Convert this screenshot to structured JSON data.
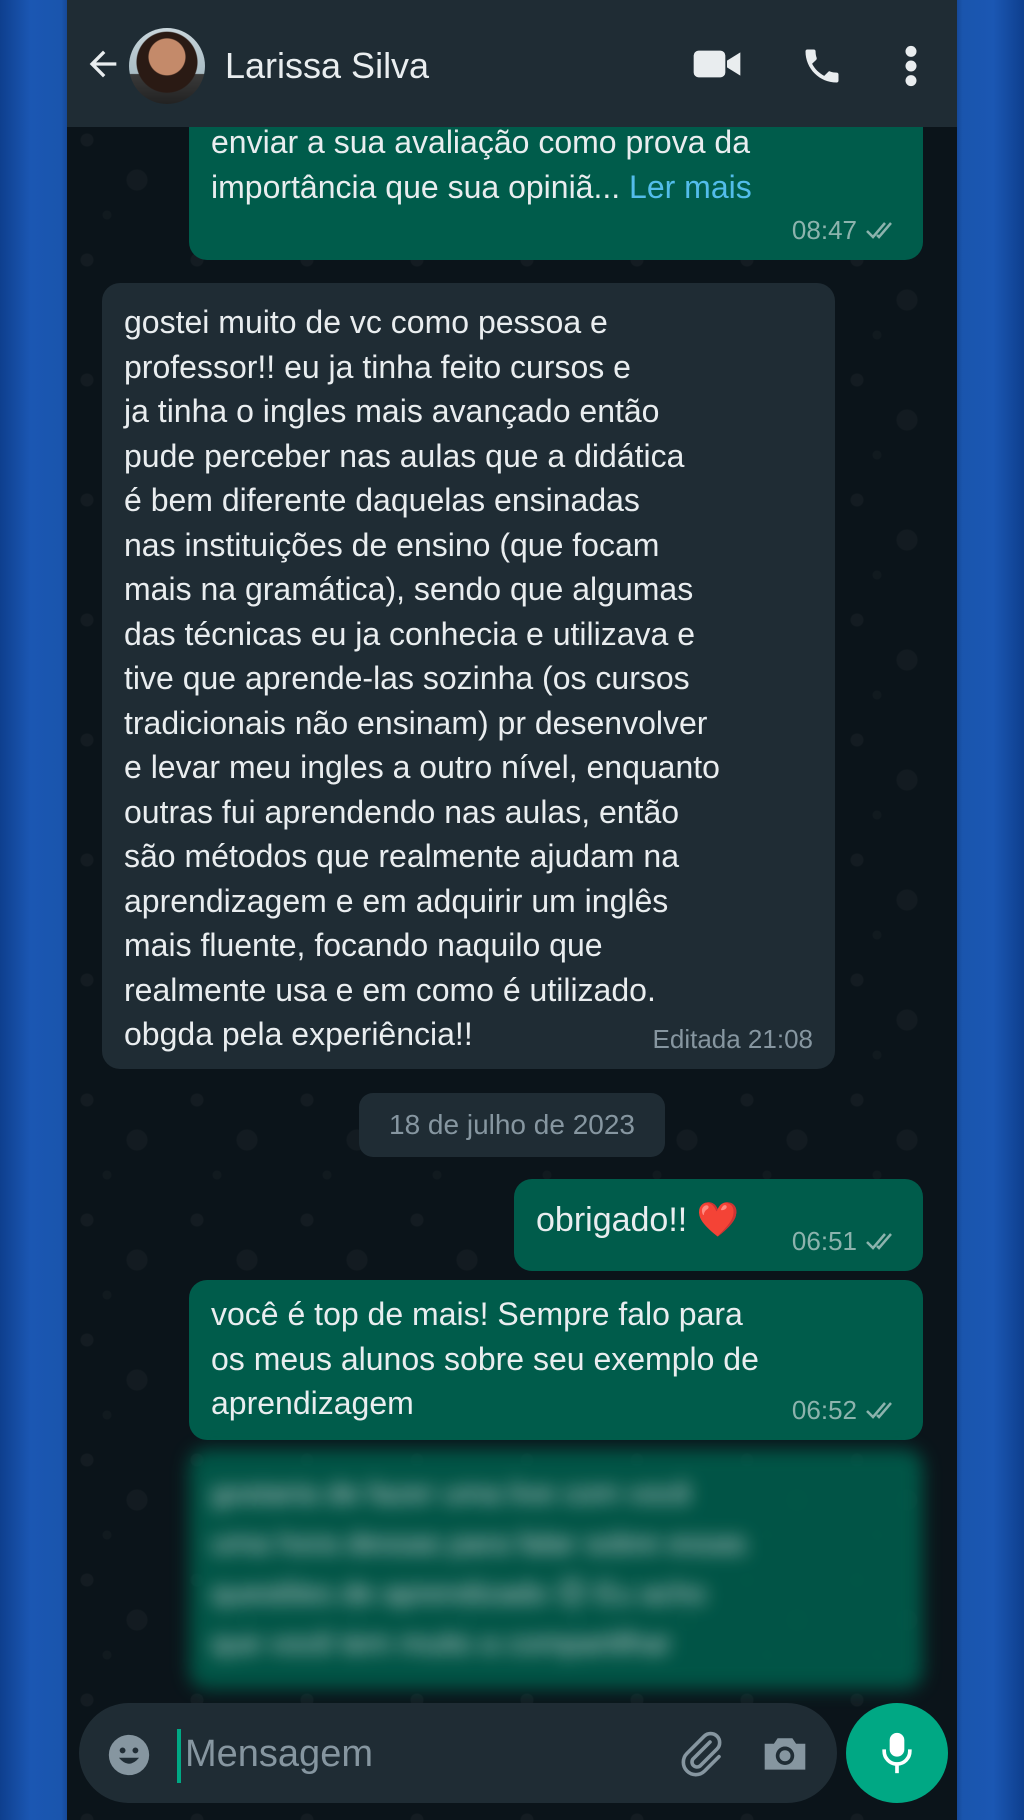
{
  "header": {
    "contact_name": "Larissa Silva",
    "back_icon": "arrow-left-icon",
    "video_icon": "video-call-icon",
    "call_icon": "phone-icon",
    "menu_icon": "more-vertical-icon"
  },
  "messages": [
    {
      "direction": "outgoing",
      "text": "enviar a sua avaliação como prova da\nimportância que sua opiniã...",
      "read_more": " Ler mais",
      "time": "08:47",
      "status": "read"
    },
    {
      "direction": "incoming",
      "text": "gostei muito de vc como pessoa e\nprofessor!! eu ja tinha feito cursos e\nja tinha o ingles mais avançado então\npude perceber nas aulas que a didática\né bem diferente daquelas ensinadas\nnas instituições de ensino (que focam\nmais na gramática), sendo que algumas\ndas técnicas eu ja conhecia e utilizava e\ntive que aprende-las sozinha (os cursos\ntradicionais não ensinam) pr desenvolver\ne levar meu ingles a outro nível, enquanto\noutras fui aprendendo nas aulas, então\nsão métodos que realmente ajudam na\naprendizagem e em adquirir um inglês\nmais fluente, focando naquilo que\nrealmente usa e em como é utilizado.\nobgda pela experiência!!",
      "time": "Editada 21:08"
    },
    {
      "direction": "outgoing",
      "text": "obrigado!! ❤️",
      "time": "06:51",
      "status": "read"
    },
    {
      "direction": "outgoing",
      "text": "você é top de mais! Sempre falo para\nos meus alunos sobre seu exemplo de\naprendizagem",
      "time": "06:52",
      "status": "read"
    },
    {
      "direction": "outgoing",
      "blurred": true,
      "text": "gostaria de fazer uma live com você\numa hora dessas para falar sobre essas\nquestões de aprendizado 😊 Eu acho\nque você tem muito a compartilhar"
    }
  ],
  "date_separator": "18 de julho de 2023",
  "composer": {
    "placeholder": "Mensagem",
    "emoji_icon": "emoji-icon",
    "attach_icon": "paperclip-icon",
    "camera_icon": "camera-icon",
    "mic_icon": "microphone-icon"
  },
  "colors": {
    "header_bg": "#1f2c34",
    "chat_bg": "#0b141a",
    "outgoing_bubble": "#005c4b",
    "incoming_bubble": "#1f2c34",
    "accent": "#00a884",
    "link": "#53bdeb"
  }
}
